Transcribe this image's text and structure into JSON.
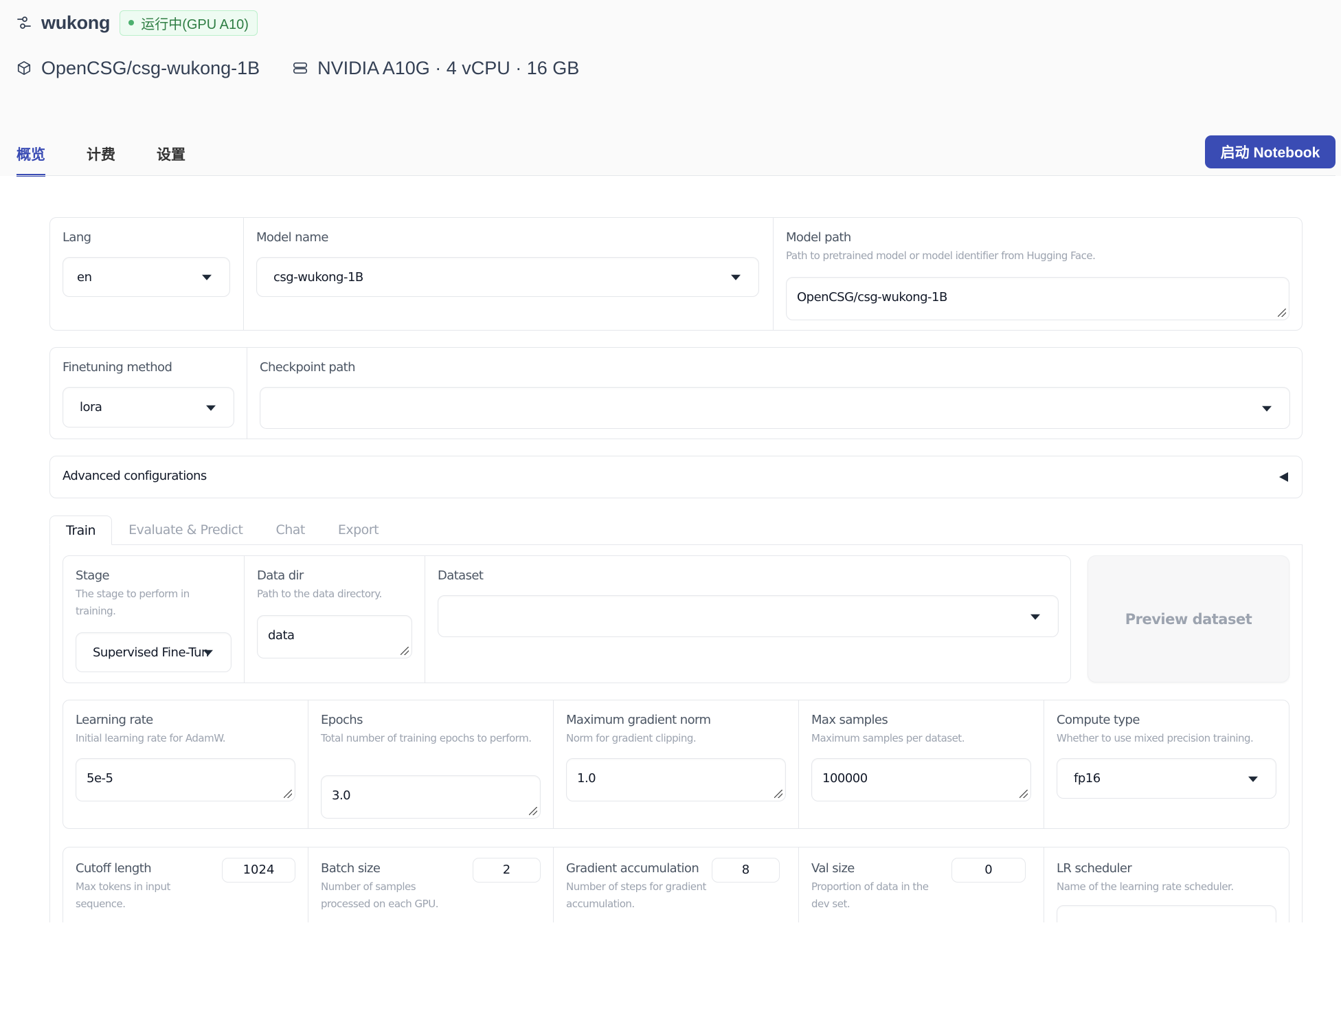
{
  "header": {
    "app_name": "wukong",
    "status": "运行中(GPU A10)",
    "status_color": "#2e7d43",
    "model_repo": "OpenCSG/csg-wukong-1B",
    "hardware": "NVIDIA A10G · 4 vCPU · 16 GB",
    "icons": {
      "app": "sliders-icon",
      "model": "cube-icon",
      "hardware": "server-icon"
    }
  },
  "nav": {
    "tabs": [
      {
        "label": "概览",
        "active": true
      },
      {
        "label": "计费",
        "active": false
      },
      {
        "label": "设置",
        "active": false
      }
    ],
    "accent_color": "#3a4cb4"
  },
  "actions": {
    "launch_notebook": "启动 Notebook"
  },
  "top_config": {
    "lang": {
      "label": "Lang",
      "value": "en"
    },
    "model_name": {
      "label": "Model name",
      "value": "csg-wukong-1B"
    },
    "model_path": {
      "label": "Model path",
      "description": "Path to pretrained model or model identifier from Hugging Face.",
      "value": "OpenCSG/csg-wukong-1B"
    },
    "finetuning_method": {
      "label": "Finetuning method",
      "value": "lora"
    },
    "checkpoint_path": {
      "label": "Checkpoint path",
      "value": ""
    },
    "advanced": {
      "label": "Advanced configurations",
      "expanded": false
    }
  },
  "sub_tabs": [
    {
      "label": "Train",
      "active": true
    },
    {
      "label": "Evaluate & Predict",
      "active": false
    },
    {
      "label": "Chat",
      "active": false
    },
    {
      "label": "Export",
      "active": false
    }
  ],
  "train": {
    "stage": {
      "label": "Stage",
      "description": "The stage to perform in training.",
      "value": "Supervised Fine-Tun"
    },
    "data_dir": {
      "label": "Data dir",
      "description": "Path to the data directory.",
      "value": "data"
    },
    "dataset": {
      "label": "Dataset",
      "value": ""
    },
    "preview_dataset": "Preview dataset",
    "learning_rate": {
      "label": "Learning rate",
      "description": "Initial learning rate for AdamW.",
      "value": "5e-5"
    },
    "epochs": {
      "label": "Epochs",
      "description": "Total number of training epochs to perform.",
      "value": "3.0"
    },
    "max_grad_norm": {
      "label": "Maximum gradient norm",
      "description": "Norm for gradient clipping.",
      "value": "1.0"
    },
    "max_samples": {
      "label": "Max samples",
      "description": "Maximum samples per dataset.",
      "value": "100000"
    },
    "compute_type": {
      "label": "Compute type",
      "description": "Whether to use mixed precision training.",
      "value": "fp16"
    },
    "cutoff_len": {
      "label": "Cutoff length",
      "description": "Max tokens in input sequence.",
      "value": "1024"
    },
    "batch_size": {
      "label": "Batch size",
      "description": "Number of samples processed on each GPU.",
      "value": "2"
    },
    "grad_accum": {
      "label": "Gradient accumulation",
      "description": "Number of steps for gradient accumulation.",
      "value": "8"
    },
    "val_size": {
      "label": "Val size",
      "description": "Proportion of data in the dev set.",
      "value": "0"
    },
    "lr_scheduler": {
      "label": "LR scheduler",
      "description": "Name of the learning rate scheduler.",
      "value": ""
    }
  }
}
